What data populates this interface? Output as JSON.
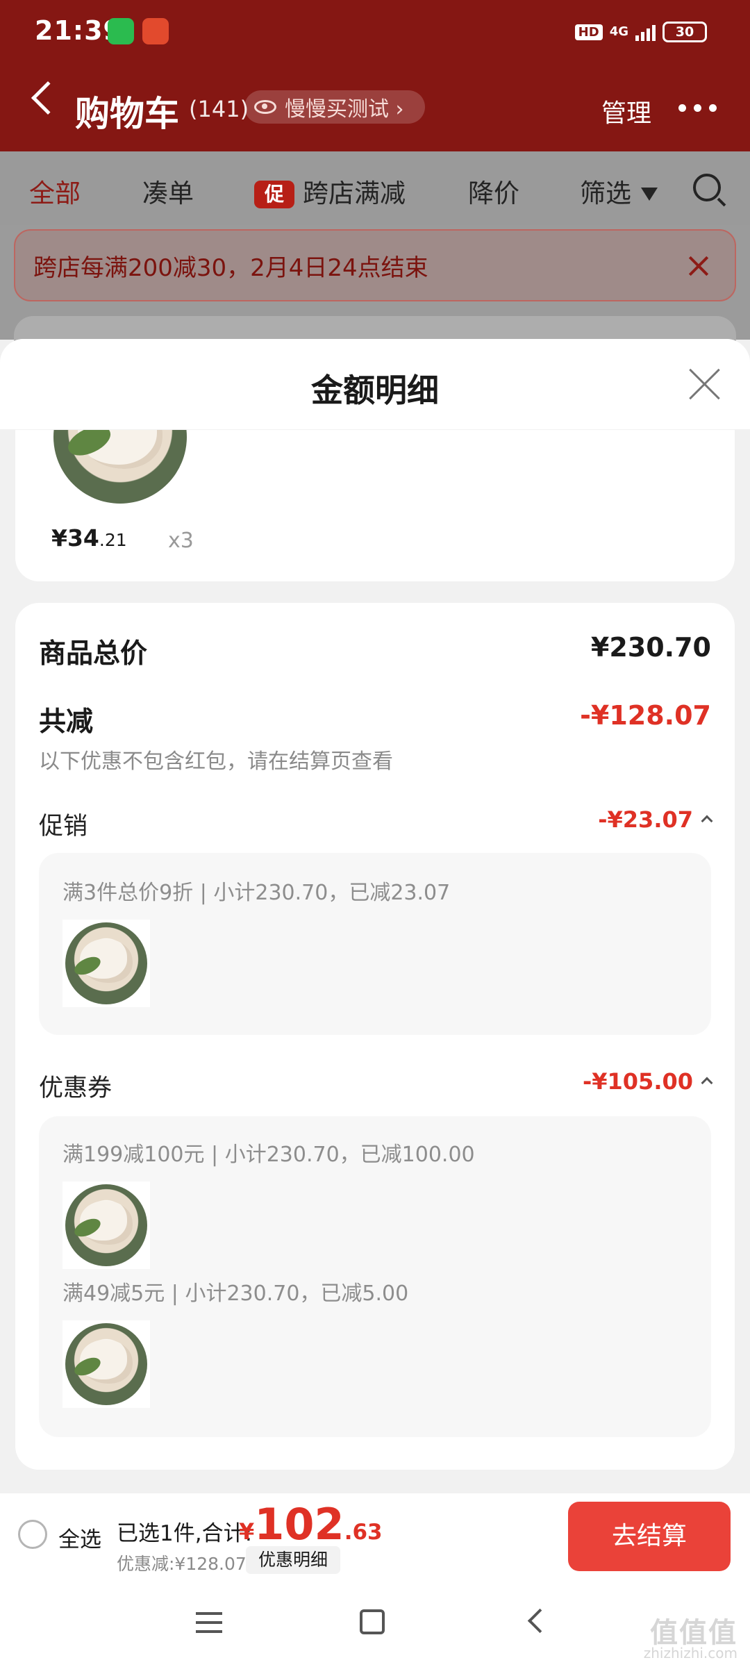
{
  "status": {
    "time": "21:39",
    "hd": "HD",
    "network": "4G",
    "battery": "30"
  },
  "header": {
    "title": "购物车",
    "count": "(141)",
    "test_pill": "慢慢买测试 ›",
    "manage": "管理"
  },
  "tabs": [
    {
      "label": "全部"
    },
    {
      "label": "凑单"
    },
    {
      "tag": "促",
      "label": "跨店满减"
    },
    {
      "label": "降价"
    },
    {
      "label": "筛选"
    }
  ],
  "banner": {
    "text": "跨店每满200减30，2月4日24点结束"
  },
  "sheet": {
    "title": "金额明细",
    "top_price": {
      "main": "¥34",
      "decimal": ".21"
    },
    "quantity": "x3",
    "summary": {
      "goods_total_label": "商品总价",
      "goods_total_value": "¥230.70",
      "reduction_label": "共减",
      "reduction_value": "-¥128.07",
      "note": "以下优惠不包含红包，请在结算页查看",
      "promotion_label": "促销",
      "promotion_value": "-¥23.07",
      "promotion_detail": "满3件总价9折 | 小计230.70，已减23.07",
      "coupon_label": "优惠券",
      "coupon_value": "-¥105.00",
      "coupon_detail_1": "满199减100元 | 小计230.70，已减100.00",
      "coupon_detail_2": "满49减5元 | 小计230.70，已减5.00"
    }
  },
  "bottom": {
    "select_all": "全选",
    "selected_text": "已选1件,合计:",
    "total_yen": "¥",
    "total_main": "102",
    "total_decimal": ".63",
    "discount": "优惠减:¥128.07",
    "detail_button": "优惠明细",
    "checkout": "去结算"
  },
  "watermark": {
    "main": "值值值",
    "sub": "zhizhizhi.com"
  },
  "colors": {
    "header": "#851713",
    "accent": "#df3125",
    "checkout": "#ea4239"
  }
}
